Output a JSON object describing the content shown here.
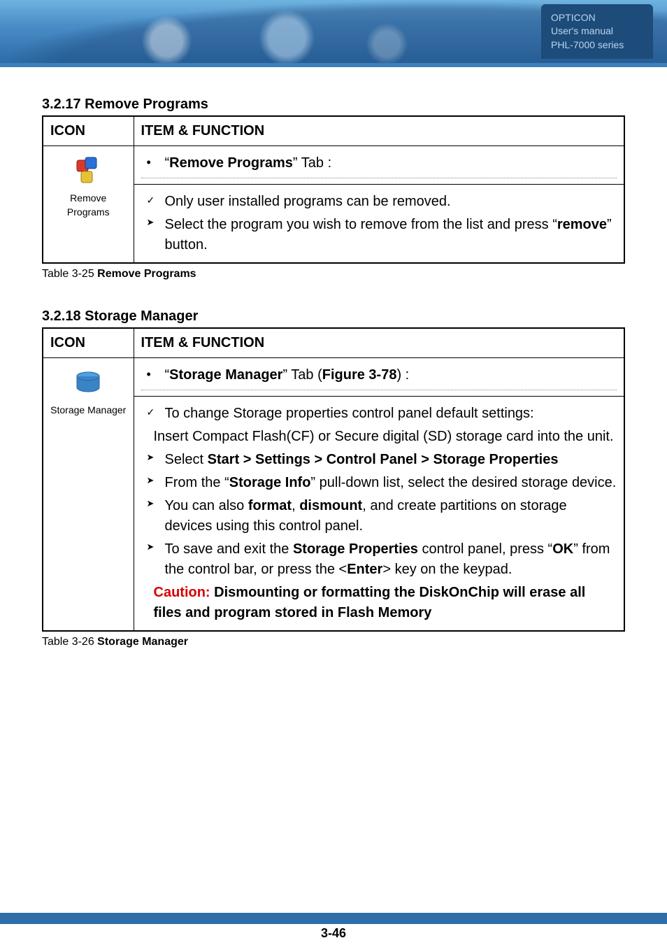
{
  "header": {
    "brand": "OPTICON",
    "line2": "User's manual",
    "line3": "PHL-7000 series"
  },
  "section1": {
    "heading": "3.2.17 Remove Programs",
    "col_icon_header": "ICON",
    "col_func_header": "ITEM & FUNCTION",
    "icon_label": "Remove Programs",
    "icon_name": "remove-programs-icon",
    "tab_header_prefix": "“",
    "tab_header_bold": "Remove Programs",
    "tab_header_suffix": "” Tab :",
    "body_items": [
      {
        "marker": "check",
        "html": "Only user installed programs can be removed."
      },
      {
        "marker": "arr",
        "html": "Select the program you wish to remove from the list and press “<b>remove</b>” button."
      }
    ],
    "caption_prefix": "Table 3-25 ",
    "caption_bold": "Remove Programs"
  },
  "section2": {
    "heading": "3.2.18 Storage Manager",
    "col_icon_header": "ICON",
    "col_func_header": "ITEM & FUNCTION",
    "icon_label": "Storage Manager",
    "icon_name": "storage-manager-icon",
    "tab_header_prefix": "“",
    "tab_header_bold": "Storage Manager",
    "tab_header_mid": "” Tab (",
    "tab_header_bold2": "Figure 3-78",
    "tab_header_suffix": ") :",
    "body_items": [
      {
        "marker": "check",
        "html": "To change Storage properties control panel default settings:"
      },
      {
        "marker": "none",
        "html": "Insert Compact Flash(CF) or Secure digital (SD) storage card into the unit.",
        "indent": true
      },
      {
        "marker": "arr",
        "html": "Select <b>Start > Settings > Control Panel > Storage Properties</b>"
      },
      {
        "marker": "arr",
        "html": "From the “<b>Storage Info</b>” pull-down list, select the desired storage device."
      },
      {
        "marker": "arr",
        "html": "You can also <b>format</b>, <b>dismount</b>, and create partitions on storage devices using this control panel."
      },
      {
        "marker": "arr",
        "html": "To save and exit the <b>Storage Properties</b> control panel, press “<b>OK</b>” from the control bar, or press the &lt;<b>Enter</b>&gt; key on the keypad."
      },
      {
        "marker": "none",
        "html": "<span class='caution'>Caution:</span> <b>Dismounting or formatting the DiskOnChip will erase all files and program stored in Flash Memory</b>",
        "indent": true
      }
    ],
    "caption_prefix": "Table 3-26 ",
    "caption_bold": "Storage Manager"
  },
  "page_number": "3-46"
}
